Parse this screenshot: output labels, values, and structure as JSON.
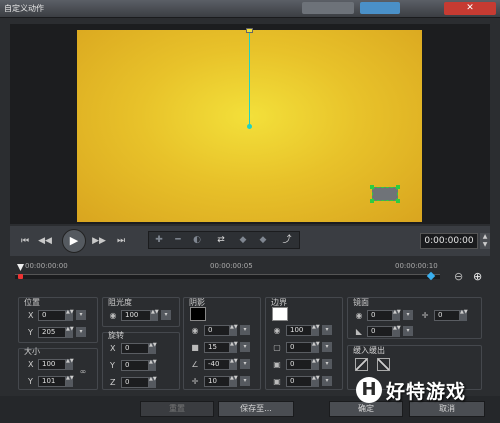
{
  "window": {
    "title": "自定义动作",
    "close_label": "✕"
  },
  "transport": {
    "timecode": "0:00:00:00",
    "buttons": [
      "⏮",
      "◀◀",
      "▶",
      "▶▶",
      "⏭"
    ]
  },
  "timeline": {
    "ticks": [
      "00:00:00:00",
      "00:00:00:05",
      "00:00:00:10"
    ]
  },
  "position": {
    "title": "位置",
    "x_label": "X",
    "x_value": "0",
    "y_label": "Y",
    "y_value": "205"
  },
  "size": {
    "title": "大小",
    "x_label": "X",
    "x_value": "100",
    "y_label": "Y",
    "y_value": "101"
  },
  "opacity": {
    "title": "阻光度",
    "value": "100"
  },
  "rotation": {
    "title": "旋转",
    "x_label": "X",
    "x_value": "0",
    "y_label": "Y",
    "y_value": "0",
    "z_label": "Z",
    "z_value": "0"
  },
  "shadow": {
    "title": "阴影",
    "values": [
      "0",
      "15",
      "-40",
      "10"
    ],
    "color": "#000000"
  },
  "border": {
    "title": "边界",
    "values": [
      "100",
      "0",
      "0",
      "0",
      "0"
    ],
    "color": "#ffffff"
  },
  "mirror": {
    "title": "镜面",
    "values": [
      "0",
      "0",
      "0"
    ]
  },
  "fade": {
    "title": "缓入缓出"
  },
  "footer": {
    "reset": "重置",
    "save_as": "保存至...",
    "ok": "确定",
    "cancel": "取消"
  },
  "watermark": {
    "logo": "H",
    "text": "好特游戏"
  }
}
